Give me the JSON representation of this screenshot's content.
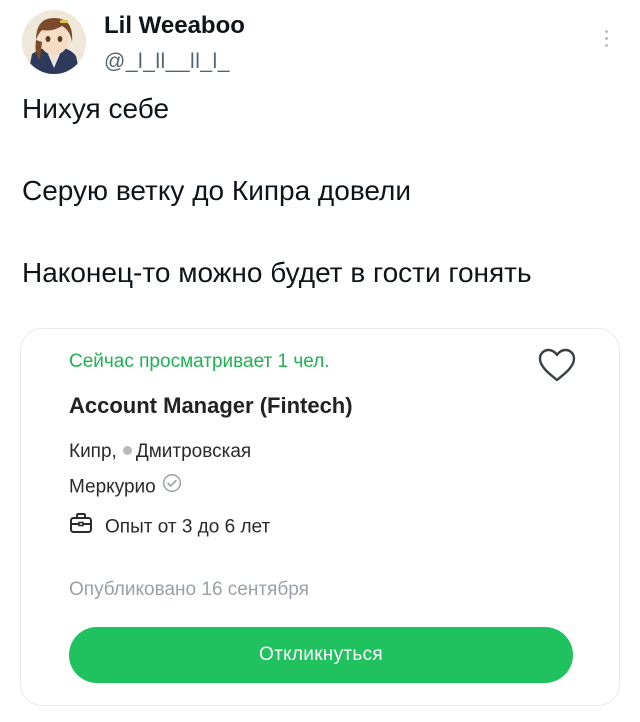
{
  "tweet": {
    "author": {
      "name": "Lil Weeaboo",
      "handle": "@_l_ll__ll_l_"
    },
    "lines": [
      "Нихуя себе",
      "Серую ветку до Кипра довели",
      "Наконец-то можно будет в гости гонять"
    ]
  },
  "vacancy": {
    "viewers": "Сейчас просматривает 1 чел.",
    "title": "Account Manager (Fintech)",
    "city": "Кипр,",
    "metro": "Дмитровская",
    "company": "Меркурио",
    "experience": "Опыт от 3 до 6 лет",
    "published": "Опубликовано 16 сентября",
    "apply_label": "Откликнуться"
  },
  "colors": {
    "accent_green": "#1fc25e",
    "viewers_green": "#1fb254",
    "muted_text": "#9aa0a6"
  },
  "icons": {
    "favorite": "heart-icon",
    "verified": "check-circle-icon",
    "experience": "briefcase-icon",
    "menu": "more-vertical-icon"
  }
}
